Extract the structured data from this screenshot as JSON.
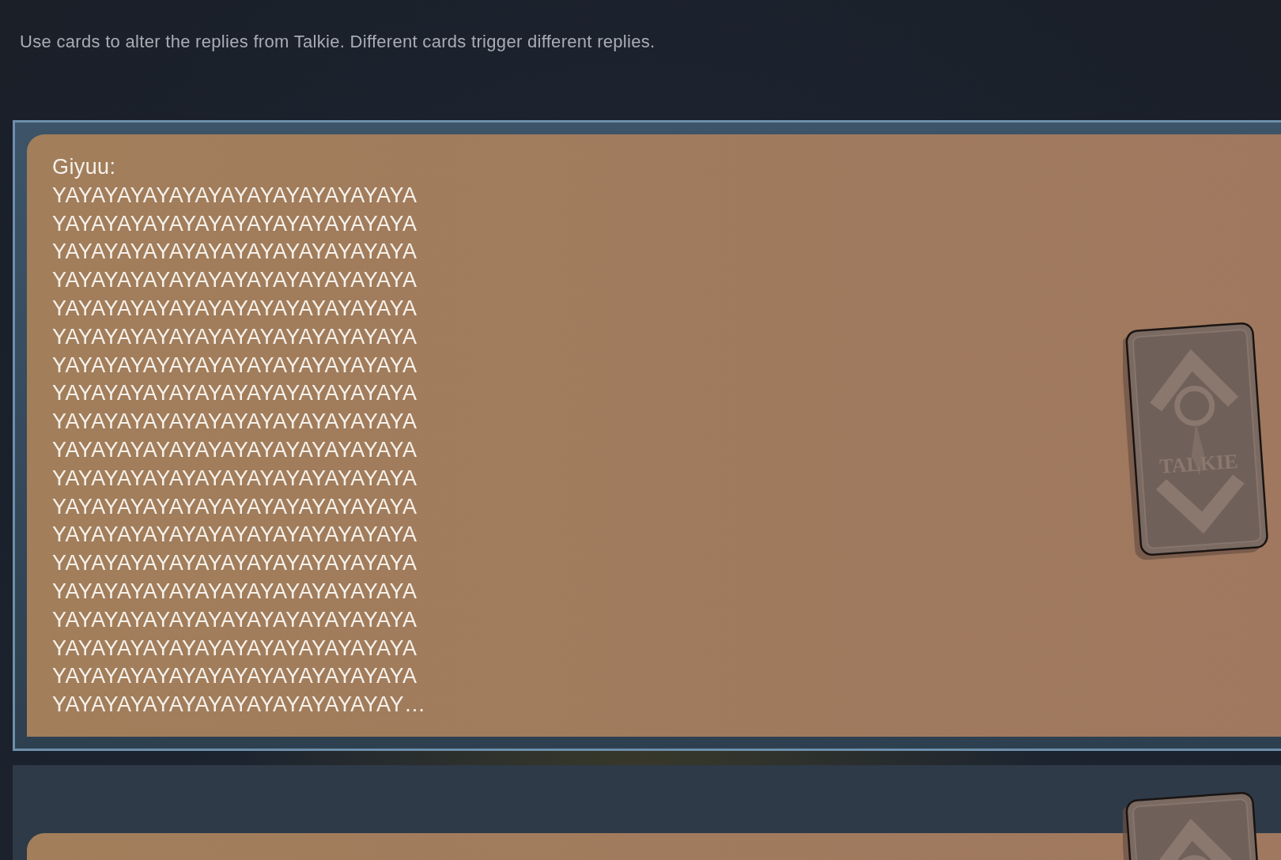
{
  "description": "Use cards to alter the replies from Talkie. Different cards trigger different replies.",
  "replies": [
    {
      "speaker": "Giyuu:",
      "lines": [
        "YAYAYAYAYAYAYAYAYAYAYAYAYAYA",
        "YAYAYAYAYAYAYAYAYAYAYAYAYAYA",
        "YAYAYAYAYAYAYAYAYAYAYAYAYAYA",
        "YAYAYAYAYAYAYAYAYAYAYAYAYAYA",
        "YAYAYAYAYAYAYAYAYAYAYAYAYAYA",
        "YAYAYAYAYAYAYAYAYAYAYAYAYAYA",
        "YAYAYAYAYAYAYAYAYAYAYAYAYAYA",
        "YAYAYAYAYAYAYAYAYAYAYAYAYAYA",
        "YAYAYAYAYAYAYAYAYAYAYAYAYAYA",
        "YAYAYAYAYAYAYAYAYAYAYAYAYAYA",
        "YAYAYAYAYAYAYAYAYAYAYAYAYAYA",
        "YAYAYAYAYAYAYAYAYAYAYAYAYAYA",
        "YAYAYAYAYAYAYAYAYAYAYAYAYAYA",
        "YAYAYAYAYAYAYAYAYAYAYAYAYAYA",
        "YAYAYAYAYAYAYAYAYAYAYAYAYAYA",
        "YAYAYAYAYAYAYAYAYAYAYAYAYAYA",
        "YAYAYAYAYAYAYAYAYAYAYAYAYAYA",
        "YAYAYAYAYAYAYAYAYAYAYAYAYAYA",
        "YAYAYAYAYAYAYAYAYAYAYAYAYAY…"
      ],
      "selected": true,
      "card_logo": "TALKIE"
    },
    {
      "selected": false
    }
  ]
}
